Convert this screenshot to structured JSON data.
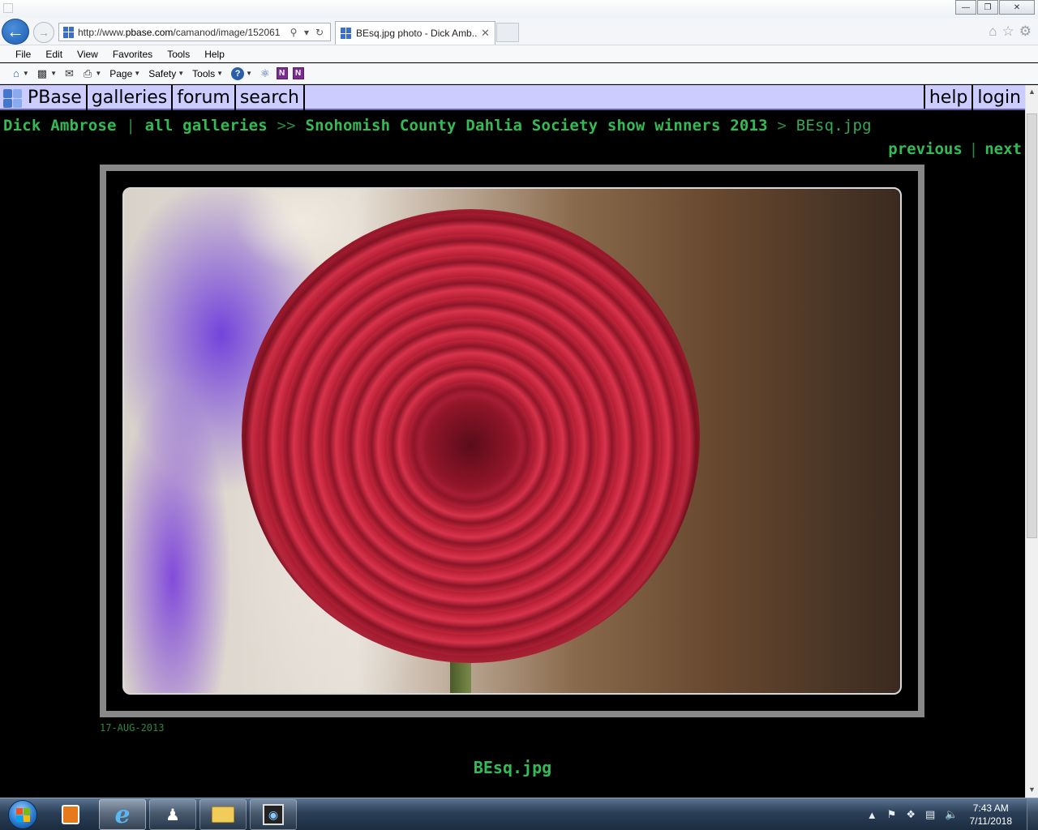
{
  "browser": {
    "url_prefix": "http://www.",
    "url_domain": "pbase.com",
    "url_rest": "/camanod/image/152061",
    "tab_title": "BEsq.jpg photo - Dick Amb...",
    "menu": [
      "File",
      "Edit",
      "View",
      "Favorites",
      "Tools",
      "Help"
    ],
    "commands": {
      "page": "Page",
      "safety": "Safety",
      "tools": "Tools"
    }
  },
  "site": {
    "logo": "PBase",
    "nav_left": [
      "galleries",
      "forum",
      "search"
    ],
    "nav_right": [
      "help",
      "login"
    ]
  },
  "breadcrumb": {
    "user": "Dick Ambrose",
    "sep1": "|",
    "all": "all galleries",
    "sep2": ">>",
    "gallery": "Snohomish County Dahlia Society show winners 2013",
    "sep3": ">",
    "current": "BEsq.jpg"
  },
  "pager": {
    "previous": "previous",
    "sep": "|",
    "next": "next"
  },
  "photo": {
    "date": "17-AUG-2013",
    "caption": "BEsq.jpg"
  },
  "taskbar": {
    "time": "7:43 AM",
    "date": "7/11/2018"
  },
  "colors": {
    "link": "#33bb55",
    "nav_bg": "#ccccff",
    "page_bg": "#000000"
  }
}
